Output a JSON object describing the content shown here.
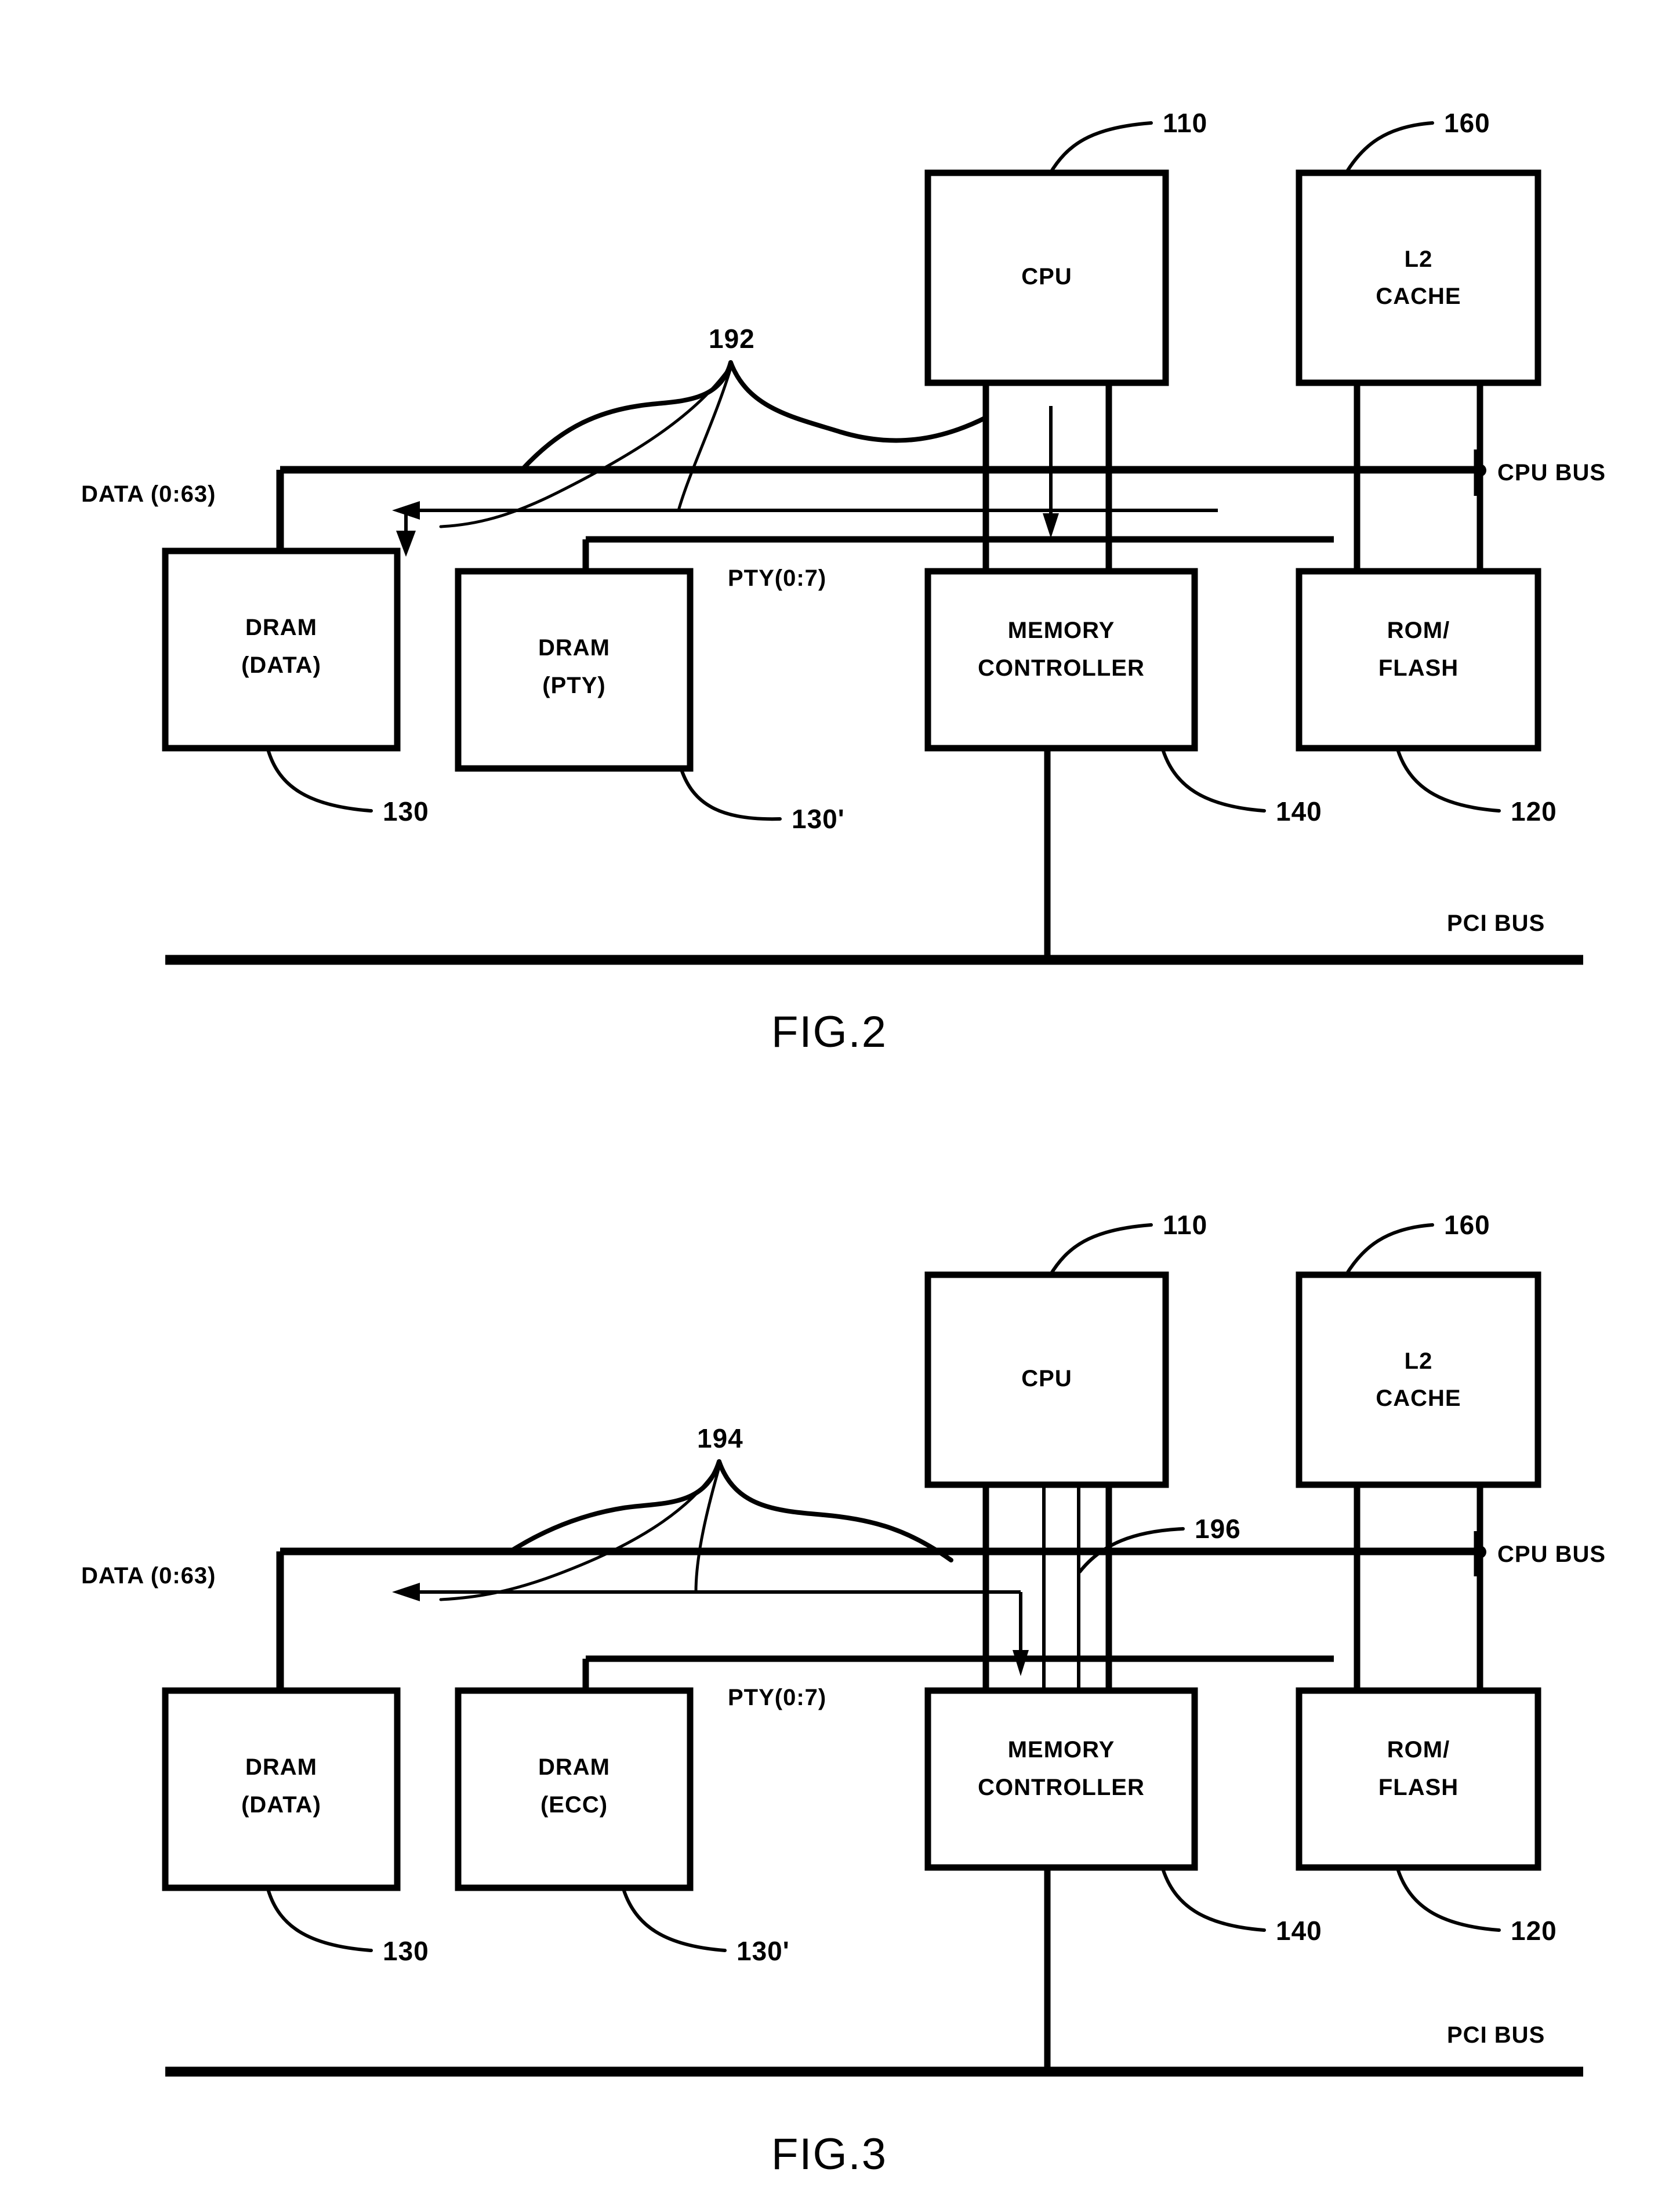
{
  "document": {
    "type": "patent-drawing-sheet",
    "figures": [
      {
        "id": "fig2",
        "caption": "FIG.2",
        "blocks": [
          {
            "key": "cpu",
            "label_line1": "CPU",
            "label_line2": "",
            "ref": "110"
          },
          {
            "key": "l2cache",
            "label_line1": "L2",
            "label_line2": "CACHE",
            "ref": "160"
          },
          {
            "key": "dram_data",
            "label_line1": "DRAM",
            "label_line2": "(DATA)",
            "ref": "130"
          },
          {
            "key": "dram_pty",
            "label_line1": "DRAM",
            "label_line2": "(PTY)",
            "ref": "130'"
          },
          {
            "key": "memctl",
            "label_line1": "MEMORY",
            "label_line2": "CONTROLLER",
            "ref": "140"
          },
          {
            "key": "romflash",
            "label_line1": "ROM/",
            "label_line2": "FLASH",
            "ref": "120"
          }
        ],
        "signals": [
          {
            "key": "data_bus",
            "label": "DATA (0:63)"
          },
          {
            "key": "pty_bus",
            "label": "PTY(0:7)"
          },
          {
            "key": "cpu_bus",
            "label": "CPU BUS"
          },
          {
            "key": "pci_bus",
            "label": "PCI BUS"
          }
        ],
        "callouts": [
          {
            "key": "bus_pair",
            "ref": "192"
          }
        ]
      },
      {
        "id": "fig3",
        "caption": "FIG.3",
        "blocks": [
          {
            "key": "cpu",
            "label_line1": "CPU",
            "label_line2": "",
            "ref": "110"
          },
          {
            "key": "l2cache",
            "label_line1": "L2",
            "label_line2": "CACHE",
            "ref": "160"
          },
          {
            "key": "dram_data",
            "label_line1": "DRAM",
            "label_line2": "(DATA)",
            "ref": "130"
          },
          {
            "key": "dram_ecc",
            "label_line1": "DRAM",
            "label_line2": "(ECC)",
            "ref": "130'"
          },
          {
            "key": "memctl",
            "label_line1": "MEMORY",
            "label_line2": "CONTROLLER",
            "ref": "140"
          },
          {
            "key": "romflash",
            "label_line1": "ROM/",
            "label_line2": "FLASH",
            "ref": "120"
          }
        ],
        "signals": [
          {
            "key": "data_bus",
            "label": "DATA (0:63)"
          },
          {
            "key": "pty_bus",
            "label": "PTY(0:7)"
          },
          {
            "key": "cpu_bus",
            "label": "CPU BUS"
          },
          {
            "key": "pci_bus",
            "label": "PCI BUS"
          }
        ],
        "callouts": [
          {
            "key": "bus_pair",
            "ref": "194"
          },
          {
            "key": "cpu_chan",
            "ref": "196"
          }
        ]
      }
    ],
    "colors": {
      "ink": "#000000",
      "paper": "#ffffff"
    }
  }
}
